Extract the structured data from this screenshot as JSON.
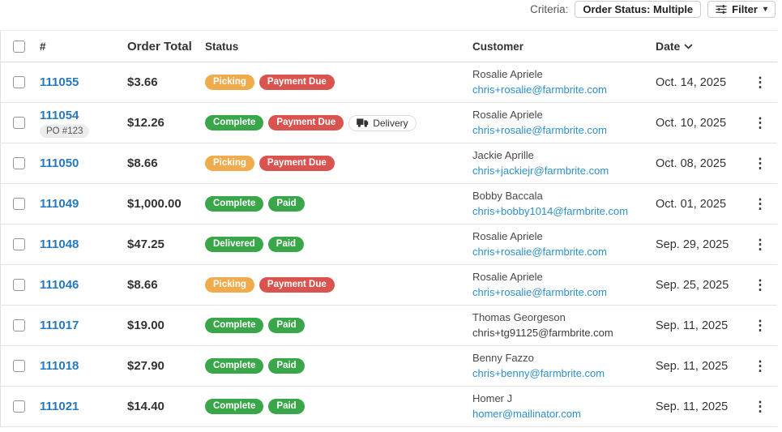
{
  "criteria_bar": {
    "label": "Criteria:",
    "criteria_chip": "Order Status: Multiple",
    "filter_label": "Filter",
    "filter_icon": "sliders-icon",
    "caret_icon": "caret-down-icon"
  },
  "icons": {
    "kebab": "⋮",
    "caret_down": "▾"
  },
  "colors": {
    "badge_warning": "#efab4c",
    "badge_danger": "#d9534f",
    "badge_success": "#3aa64a",
    "order_link_blue": "#2779bd",
    "email_link_blue": "#2e90c8"
  },
  "table": {
    "headers": {
      "number": "#",
      "order_total": "Order Total",
      "status": "Status",
      "customer": "Customer",
      "date": "Date"
    },
    "sort_column": "Date",
    "sort_icon": "chevron-down-icon",
    "rows": [
      {
        "id": "111055",
        "po": "",
        "total": "$3.66",
        "badges": [
          {
            "label": "Picking",
            "type": "warning"
          },
          {
            "label": "Payment Due",
            "type": "danger"
          }
        ],
        "customer": "Rosalie Apriele",
        "email": "chris+rosalie@farmbrite.com",
        "email_link": true,
        "date": "Oct. 14, 2025"
      },
      {
        "id": "111054",
        "po": "PO #123",
        "total": "$12.26",
        "badges": [
          {
            "label": "Complete",
            "type": "success"
          },
          {
            "label": "Payment Due",
            "type": "danger"
          },
          {
            "label": "Delivery",
            "type": "outline",
            "icon": "truck-icon"
          }
        ],
        "customer": "Rosalie Apriele",
        "email": "chris+rosalie@farmbrite.com",
        "email_link": true,
        "date": "Oct. 10, 2025"
      },
      {
        "id": "111050",
        "po": "",
        "total": "$8.66",
        "badges": [
          {
            "label": "Picking",
            "type": "warning"
          },
          {
            "label": "Payment Due",
            "type": "danger"
          }
        ],
        "customer": "Jackie Aprille",
        "email": "chris+jackiejr@farmbrite.com",
        "email_link": true,
        "date": "Oct. 08, 2025"
      },
      {
        "id": "111049",
        "po": "",
        "total": "$1,000.00",
        "badges": [
          {
            "label": "Complete",
            "type": "success"
          },
          {
            "label": "Paid",
            "type": "success"
          }
        ],
        "customer": "Bobby Baccala",
        "email": "chris+bobby1014@farmbrite.com",
        "email_link": true,
        "date": "Oct. 01, 2025"
      },
      {
        "id": "111048",
        "po": "",
        "total": "$47.25",
        "badges": [
          {
            "label": "Delivered",
            "type": "success"
          },
          {
            "label": "Paid",
            "type": "success"
          }
        ],
        "customer": "Rosalie Apriele",
        "email": "chris+rosalie@farmbrite.com",
        "email_link": true,
        "date": "Sep. 29, 2025"
      },
      {
        "id": "111046",
        "po": "",
        "total": "$8.66",
        "badges": [
          {
            "label": "Picking",
            "type": "warning"
          },
          {
            "label": "Payment Due",
            "type": "danger"
          }
        ],
        "customer": "Rosalie Apriele",
        "email": "chris+rosalie@farmbrite.com",
        "email_link": true,
        "date": "Sep. 25, 2025"
      },
      {
        "id": "111017",
        "po": "",
        "total": "$19.00",
        "badges": [
          {
            "label": "Complete",
            "type": "success"
          },
          {
            "label": "Paid",
            "type": "success"
          }
        ],
        "customer": "Thomas Georgeson",
        "email": "chris+tg91125@farmbrite.com",
        "email_link": false,
        "date": "Sep. 11, 2025"
      },
      {
        "id": "111018",
        "po": "",
        "total": "$27.90",
        "badges": [
          {
            "label": "Complete",
            "type": "success"
          },
          {
            "label": "Paid",
            "type": "success"
          }
        ],
        "customer": "Benny Fazzo",
        "email": "chris+benny@farmbrite.com",
        "email_link": true,
        "date": "Sep. 11, 2025"
      },
      {
        "id": "111021",
        "po": "",
        "total": "$14.40",
        "badges": [
          {
            "label": "Complete",
            "type": "success"
          },
          {
            "label": "Paid",
            "type": "success"
          }
        ],
        "customer": "Homer J",
        "email": "homer@mailinator.com",
        "email_link": true,
        "date": "Sep. 11, 2025"
      }
    ]
  }
}
